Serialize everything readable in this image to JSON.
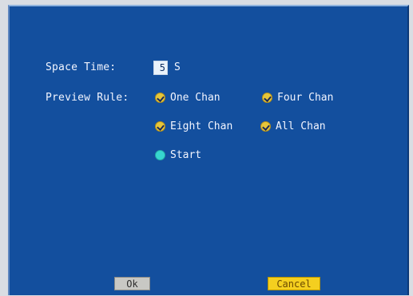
{
  "dialog": {
    "space_time": {
      "label": "Space Time:",
      "value": "5",
      "unit": "S"
    },
    "preview_rule": {
      "label": "Preview Rule:",
      "options": [
        {
          "label": "One Chan",
          "state": "checked",
          "color": "#e6c63a"
        },
        {
          "label": "Four Chan",
          "state": "checked",
          "color": "#e6c63a"
        },
        {
          "label": "Eight Chan",
          "state": "checked",
          "color": "#e6c63a"
        },
        {
          "label": "All Chan",
          "state": "checked",
          "color": "#e6c63a"
        },
        {
          "label": "Start",
          "state": "unchecked",
          "color": "#37d6cf"
        }
      ]
    },
    "buttons": {
      "ok_label": "Ok",
      "cancel_label": "Cancel"
    }
  },
  "colors": {
    "panel_background": "#134f9e",
    "text": "#f2f5ff",
    "cancel_highlight": "#f4cf1f"
  }
}
